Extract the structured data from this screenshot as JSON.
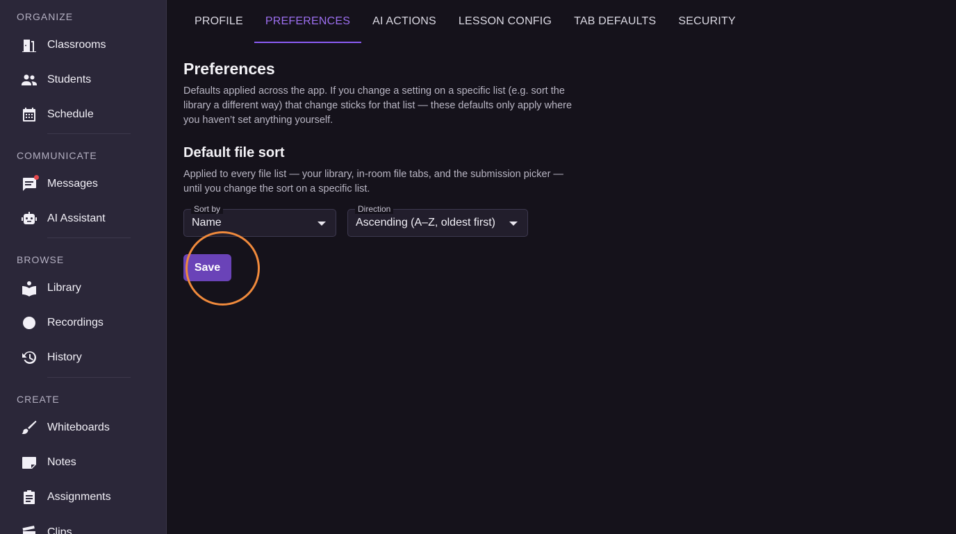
{
  "sidebar": {
    "sections": [
      {
        "header": "ORGANIZE",
        "items": [
          {
            "label": "Classrooms",
            "icon": "door-icon"
          },
          {
            "label": "Students",
            "icon": "people-icon"
          },
          {
            "label": "Schedule",
            "icon": "calendar-icon"
          }
        ]
      },
      {
        "header": "COMMUNICATE",
        "items": [
          {
            "label": "Messages",
            "icon": "chat-icon",
            "badge": true
          },
          {
            "label": "AI Assistant",
            "icon": "robot-icon"
          }
        ]
      },
      {
        "header": "BROWSE",
        "items": [
          {
            "label": "Library",
            "icon": "book-icon"
          },
          {
            "label": "Recordings",
            "icon": "record-icon"
          },
          {
            "label": "History",
            "icon": "history-icon"
          }
        ]
      },
      {
        "header": "CREATE",
        "items": [
          {
            "label": "Whiteboards",
            "icon": "brush-icon"
          },
          {
            "label": "Notes",
            "icon": "note-icon"
          },
          {
            "label": "Assignments",
            "icon": "clipboard-icon"
          },
          {
            "label": "Clips",
            "icon": "clapper-icon"
          }
        ]
      }
    ]
  },
  "tabs": [
    {
      "label": "PROFILE"
    },
    {
      "label": "PREFERENCES",
      "active": true
    },
    {
      "label": "AI ACTIONS"
    },
    {
      "label": "LESSON CONFIG"
    },
    {
      "label": "TAB DEFAULTS"
    },
    {
      "label": "SECURITY"
    }
  ],
  "preferences": {
    "title": "Preferences",
    "description": "Defaults applied across the app. If you change a setting on a specific list (e.g. sort the library a different way) that change sticks for that list — these defaults only apply where you haven’t set anything yourself.",
    "file_sort": {
      "title": "Default file sort",
      "description": "Applied to every file list — your library, in-room file tabs, and the submission picker — until you change the sort on a specific list.",
      "sort_by": {
        "label": "Sort by",
        "value": "Name"
      },
      "direction": {
        "label": "Direction",
        "value": "Ascending (A–Z, oldest first)"
      }
    },
    "save_label": "Save"
  },
  "colors": {
    "accent": "#8b5cf6",
    "button": "#6a43b8",
    "highlight_ring": "#f08a3c",
    "badge": "#e5484d"
  }
}
